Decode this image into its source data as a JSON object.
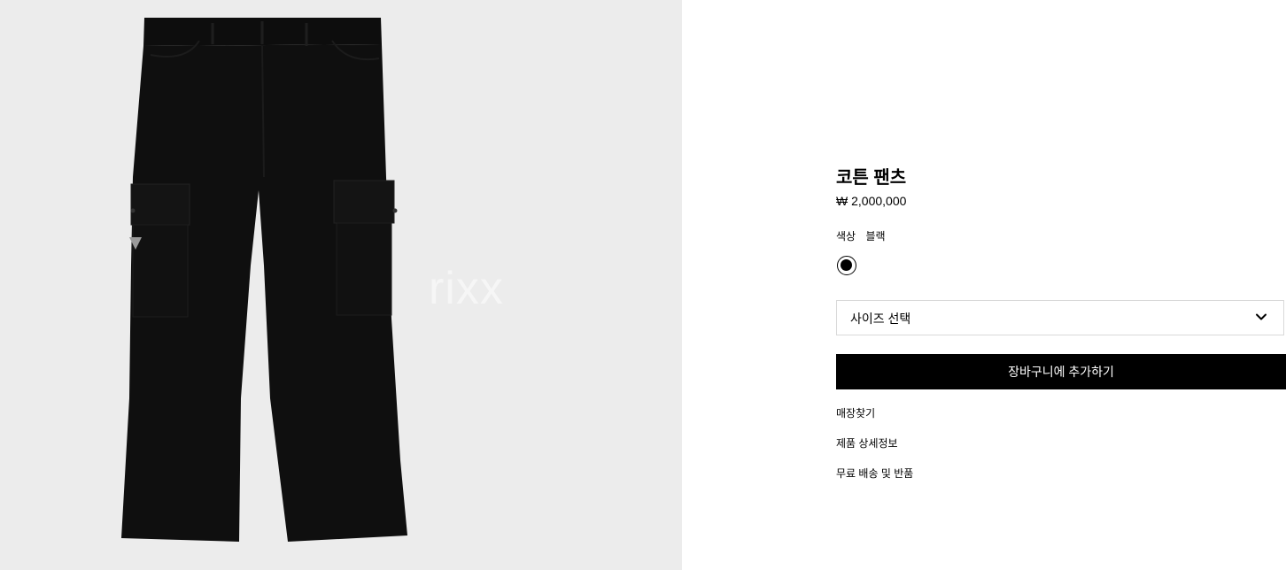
{
  "product_image": {
    "alt": "코튼 팬츠",
    "watermark": "rixx",
    "background_color": "#ececec",
    "garment_color": "#0d0d0d"
  },
  "product": {
    "title": "코튼 팬츠",
    "price": "₩ 2,000,000",
    "color_label": "색상",
    "color_value": "블랙",
    "swatch_color": "#000000"
  },
  "size_select": {
    "label": "사이즈 선택",
    "icon": "chevron-down-icon"
  },
  "actions": {
    "add_to_cart": "장바구니에 추가하기"
  },
  "links": {
    "find_store": "매장찾기",
    "product_details": "제품 상세정보",
    "shipping_returns": "무료 배송 및 반품"
  }
}
